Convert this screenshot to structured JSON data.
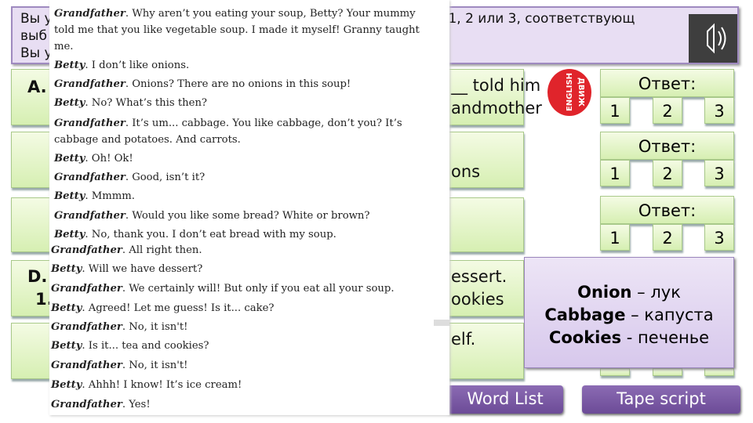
{
  "header": {
    "line1_left": "Вы у",
    "line1_right": "у 1, 2 или 3, соответствующ",
    "line2_left": "выб",
    "line3_left": "Вы у"
  },
  "speaker_icon": "speaker-icon",
  "questions": [
    {
      "label": "A.",
      "right1": "__ told him",
      "right2": "andmother"
    },
    {
      "label": "",
      "right1": "",
      "right2": "ons"
    },
    {
      "label": "",
      "right1": "",
      "right2": ""
    },
    {
      "label": "D.",
      "label2": "1.",
      "right1": "essert.",
      "right2": "ookies"
    },
    {
      "label": "",
      "right1": "",
      "right2": "elf."
    }
  ],
  "answers": [
    {
      "title": "Ответ:",
      "options": [
        "1",
        "2",
        "3"
      ]
    },
    {
      "title": "Ответ:",
      "options": [
        "1",
        "2",
        "3"
      ]
    },
    {
      "title": "Ответ:",
      "options": [
        "1",
        "2",
        "3"
      ]
    }
  ],
  "logo": {
    "text1": "ENGLISH",
    "text2": "ДВИЖ"
  },
  "vocab": [
    {
      "word": "Onion",
      "sep": " – ",
      "translation": "лук"
    },
    {
      "word": "Cabbage",
      "sep": " – ",
      "translation": "капуста"
    },
    {
      "word": "Cookies",
      "sep": " - ",
      "translation": "печенье"
    }
  ],
  "buttons": {
    "word_list": "Word List",
    "tape_script": "Tape script"
  },
  "script": [
    {
      "s": "Grandfather",
      "t": ". Why aren’t you eating your soup, Betty? Your mummy"
    },
    {
      "s": "",
      "t": "told me that you like vegetable soup. I made it myself! Granny taught"
    },
    {
      "s": "",
      "t": "me."
    },
    {
      "s": "Betty",
      "t": ". I don’t like onions."
    },
    {
      "s": "Grandfather",
      "t": ". Onions? There are no onions in this soup!"
    },
    {
      "s": "Betty",
      "t": ". No? What’s this then?"
    },
    {
      "s": "Grandfather",
      "t": ". It’s um... cabbage. You like cabbage, don’t you? It’s"
    },
    {
      "s": "",
      "t": "cabbage and potatoes. And carrots."
    },
    {
      "s": "Betty",
      "t": ". Oh! Ok!"
    },
    {
      "s": "Grandfather",
      "t": ". Good, isn’t it?"
    },
    {
      "s": "Betty",
      "t": ". Mmmm."
    },
    {
      "s": "Grandfather",
      "t": ". Would you like some bread? White or brown?"
    },
    {
      "s": "Betty",
      "t": ". No, thank you. I don’t eat bread with my soup."
    },
    {
      "s": "Grandfather",
      "t": ". All right then."
    },
    {
      "s": "Betty",
      "t": ". Will we have dessert?"
    },
    {
      "s": "Grandfather",
      "t": ". We certainly will! But only if you eat all your soup."
    },
    {
      "s": "Betty",
      "t": ". Agreed! Let me guess! Is it... cake?"
    },
    {
      "s": "Grandfather",
      "t": ". No, it isn't!"
    },
    {
      "s": "Betty",
      "t": ". Is it... tea and cookies?"
    },
    {
      "s": "Grandfather",
      "t": ". No, it isn't!"
    },
    {
      "s": "Betty",
      "t": ". Ahhh! I know! It’s ice cream!"
    },
    {
      "s": "Grandfather",
      "t": ". Yes!"
    }
  ]
}
